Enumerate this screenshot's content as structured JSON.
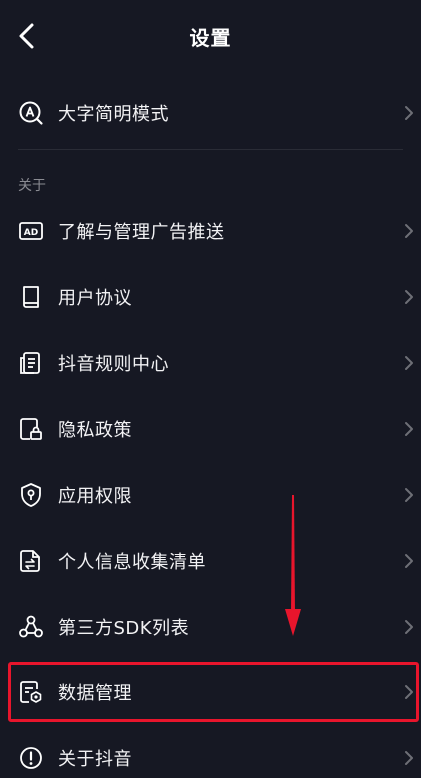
{
  "header": {
    "title": "设置"
  },
  "top_item": {
    "label": "大字简明模式",
    "icon": "large-text-icon"
  },
  "about_section": {
    "title": "关于",
    "items": [
      {
        "label": "了解与管理广告推送",
        "icon": "ad-icon"
      },
      {
        "label": "用户协议",
        "icon": "book-icon"
      },
      {
        "label": "抖音规则中心",
        "icon": "document-list-icon"
      },
      {
        "label": "隐私政策",
        "icon": "lock-document-icon"
      },
      {
        "label": "应用权限",
        "icon": "shield-icon"
      },
      {
        "label": "个人信息收集清单",
        "icon": "file-transfer-icon"
      },
      {
        "label": "第三方SDK列表",
        "icon": "network-icon"
      },
      {
        "label": "数据管理",
        "icon": "data-settings-icon"
      },
      {
        "label": "关于抖音",
        "icon": "info-icon"
      }
    ]
  },
  "colors": {
    "background": "#161823",
    "highlight": "#e8152c",
    "text": "#f2f2f4",
    "muted": "#8a8b92"
  }
}
